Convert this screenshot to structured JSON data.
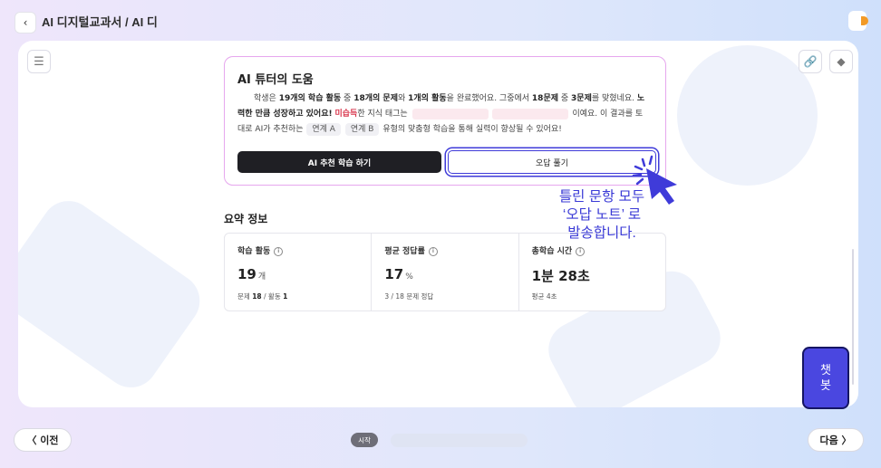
{
  "header": {
    "back_icon": "chevron-left-icon",
    "breadcrumb": "AI 디지털교과서  /  AI 디"
  },
  "toolbar": {
    "menu_icon": "hamburger-menu-icon",
    "link_icon": "link-icon",
    "settings_icon": "puzzle-icon"
  },
  "tutor": {
    "title": "AI 튜터의 도움",
    "p1": "학생은 ",
    "p1_b1": "19개의 학습 활동",
    "p2": " 중 ",
    "p2_b": "18개의 문제",
    "p3": "와 ",
    "p3_b": "1개의 활동",
    "p4": "을 완료했어요. 그중에서 ",
    "p4_b": "18문제",
    "p5": " 중 ",
    "p5_b": "3문제",
    "p6": "를 맞혔네요. ",
    "p6_b": "노력한 만큼 성장하고 있어요!",
    "p7_red": "미습득",
    "p8": "한 지식 태그는",
    "p9": "이예요. 이 결과를 토대로 AI가 추천하는",
    "chip1": "연계 A",
    "chip2": "연계 B",
    "p10": "유형의 맞춤형 학습을 통해 실력이 향상될 수 있어요!",
    "btn_ai": "AI 추천 학습 하기",
    "btn_wrong": "오답 풀기"
  },
  "summary": {
    "title": "요약 정보",
    "stats": [
      {
        "label": "학습 활동",
        "value": "19",
        "unit": "개",
        "detail_pre": "문제 ",
        "detail_b1": "18",
        "detail_mid": " / 활동 ",
        "detail_b2": "1"
      },
      {
        "label": "평균 정답률",
        "value": "17",
        "unit": "%",
        "detail_pre": "3 / 18 문제 정답",
        "detail_b1": "",
        "detail_mid": "",
        "detail_b2": ""
      },
      {
        "label": "총학습 시간",
        "value": "1분 28초",
        "unit": "",
        "detail_pre": "평균 4초",
        "detail_b1": "",
        "detail_mid": "",
        "detail_b2": ""
      }
    ]
  },
  "annotation": {
    "line1": "틀린 문항 모두",
    "line2": "‘오답 노트’ 로",
    "line3": "발송합니다."
  },
  "chatbot": {
    "line1": "챗",
    "line2": "봇"
  },
  "footer": {
    "prev": "〈 이전",
    "next": "다음 〉",
    "start": "시작"
  },
  "colors": {
    "accent": "#3f3bd9",
    "chatbot": "#4a47e0",
    "tutor_border": "#e6a7ee",
    "untaught_tag": "#d8344b"
  }
}
